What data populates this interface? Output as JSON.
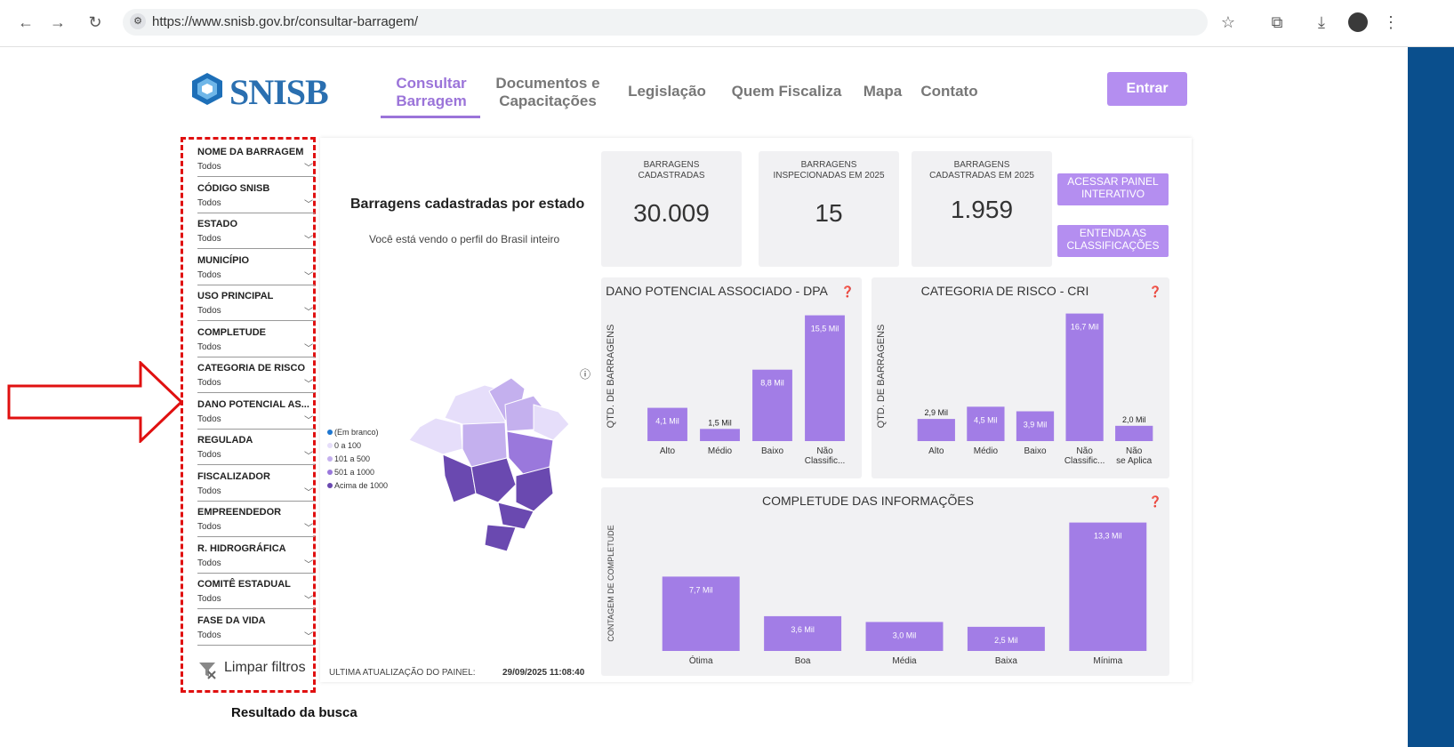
{
  "browser": {
    "url": "https://www.snisb.gov.br/consultar-barragem/"
  },
  "header": {
    "logo": "SNISB",
    "nav": [
      {
        "label": "Consultar Barragem",
        "active": true
      },
      {
        "label": "Documentos e Capacitações",
        "active": false
      },
      {
        "label": "Legislação",
        "active": false
      },
      {
        "label": "Quem Fiscaliza",
        "active": false
      },
      {
        "label": "Mapa",
        "active": false
      },
      {
        "label": "Contato",
        "active": false
      }
    ],
    "login_label": "Entrar"
  },
  "filters": [
    {
      "label": "NOME DA BARRAGEM",
      "value": "Todos"
    },
    {
      "label": "CÓDIGO SNISB",
      "value": "Todos"
    },
    {
      "label": "ESTADO",
      "value": "Todos"
    },
    {
      "label": "MUNICÍPIO",
      "value": "Todos"
    },
    {
      "label": "USO PRINCIPAL",
      "value": "Todos"
    },
    {
      "label": "COMPLETUDE",
      "value": "Todos"
    },
    {
      "label": "CATEGORIA DE RISCO",
      "value": "Todos"
    },
    {
      "label": "DANO POTENCIAL AS...",
      "value": "Todos"
    },
    {
      "label": "REGULADA",
      "value": "Todos"
    },
    {
      "label": "FISCALIZADOR",
      "value": "Todos"
    },
    {
      "label": "EMPREENDEDOR",
      "value": "Todos"
    },
    {
      "label": "R. HIDROGRÁFICA",
      "value": "Todos"
    },
    {
      "label": "COMITÊ ESTADUAL",
      "value": "Todos"
    },
    {
      "label": "FASE DA VIDA",
      "value": "Todos"
    }
  ],
  "clear_filters": "Limpar filtros",
  "result_label": "Resultado da busca",
  "map": {
    "title": "Barragens cadastradas por estado",
    "subtitle": "Você está vendo o perfil do Brasil inteiro",
    "legend": [
      {
        "label": "(Em branco)",
        "color": "#1f77d0"
      },
      {
        "label": "0 a 100",
        "color": "#e6defa"
      },
      {
        "label": "101 a 500",
        "color": "#c4b0ee"
      },
      {
        "label": "501 a 1000",
        "color": "#9a78dc"
      },
      {
        "label": "Acima de 1000",
        "color": "#6a49b0"
      }
    ]
  },
  "kpis": [
    {
      "title": "BARRAGENS CADASTRADAS",
      "value": "30.009"
    },
    {
      "title": "BARRAGENS INSPECIONADAS EM 2025",
      "value": "15"
    },
    {
      "title": "BARRAGENS CADASTRADAS EM 2025",
      "value": "1.959"
    }
  ],
  "panel_buttons": [
    {
      "label": "ACESSAR PAINEL INTERATIVO"
    },
    {
      "label": "ENTENDA AS CLASSIFICAÇÕES"
    }
  ],
  "footer": {
    "label": "ULTIMA ATUALIZAÇÃO DO PAINEL:",
    "date": "29/09/2025 11:08:40"
  },
  "colors": {
    "accent": "#b48ef0",
    "bar": "#a27de6",
    "nav_active": "#9b74d9"
  },
  "chart_data": [
    {
      "type": "bar",
      "title": "DANO POTENCIAL ASSOCIADO - DPA",
      "ylabel": "QTD. DE BARRAGENS",
      "categories": [
        "Alto",
        "Médio",
        "Baixo",
        "Não Classific..."
      ],
      "values": [
        4.1,
        1.5,
        8.8,
        15.5
      ],
      "value_labels": [
        "4,1 Mil",
        "1,5 Mil",
        "8,8 Mil",
        "15,5 Mil"
      ],
      "ylim": [
        0,
        16
      ]
    },
    {
      "type": "bar",
      "title": "CATEGORIA DE RISCO - CRI",
      "ylabel": "QTD. DE BARRAGENS",
      "categories": [
        "Alto",
        "Médio",
        "Baixo",
        "Não Classific...",
        "Não se Aplica"
      ],
      "values": [
        2.9,
        4.5,
        3.9,
        16.7,
        2.0
      ],
      "value_labels": [
        "2,9 Mil",
        "4,5 Mil",
        "3,9 Mil",
        "16,7 Mil",
        "2,0 Mil"
      ],
      "ylim": [
        0,
        17
      ]
    },
    {
      "type": "bar",
      "title": "COMPLETUDE DAS INFORMAÇÕES",
      "ylabel": "CONTAGEM DE COMPLETUDE",
      "categories": [
        "Ótima",
        "Boa",
        "Média",
        "Baixa",
        "Mínima"
      ],
      "values": [
        7.7,
        3.6,
        3.0,
        2.5,
        13.3
      ],
      "value_labels": [
        "7,7 Mil",
        "3,6 Mil",
        "3,0 Mil",
        "2,5 Mil",
        "13,3 Mil"
      ],
      "ylim": [
        0,
        14
      ]
    }
  ]
}
